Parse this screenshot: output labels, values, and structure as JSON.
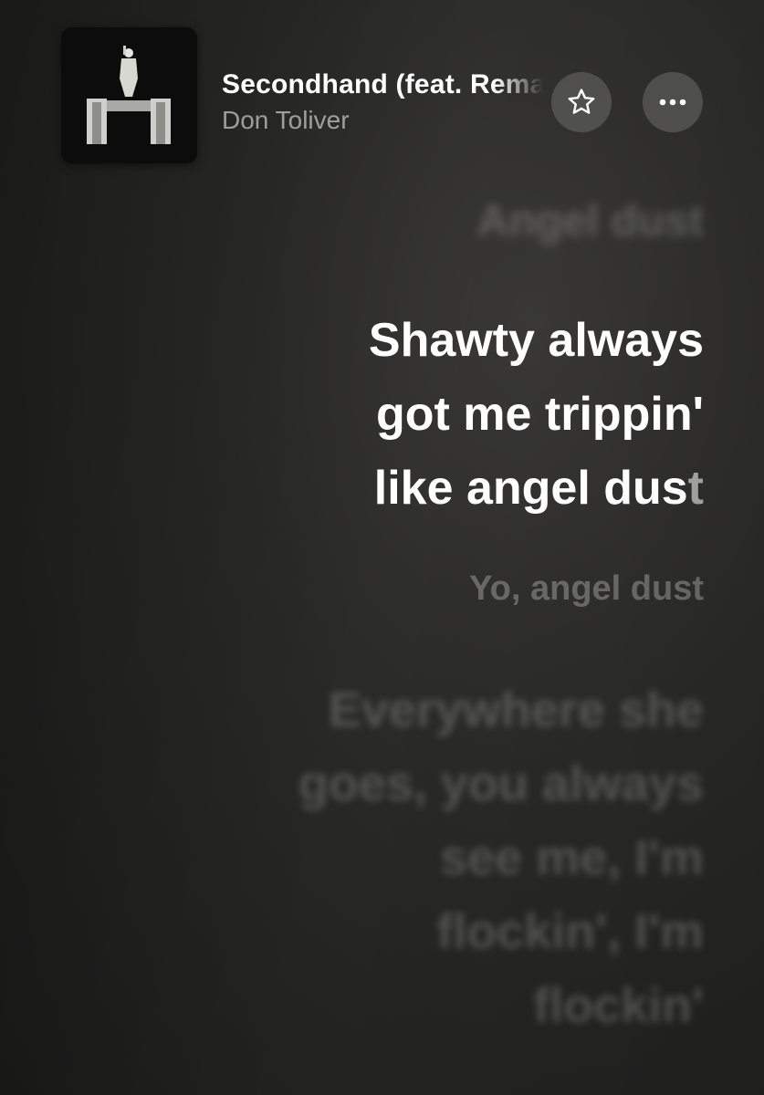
{
  "now_playing": {
    "title": "Secondhand (feat. Rema)",
    "artist": "Don Toliver"
  },
  "controls": {
    "favorite_icon": "star-outline-icon",
    "more_icon": "ellipsis-icon"
  },
  "lyrics": {
    "previous": "Angel dust",
    "active_main": "Shawty always\ngot me trippin'\nlike angel dus",
    "active_tail": "t",
    "next": "Yo, angel dust",
    "upcoming": "Everywhere she\ngoes, you always\nsee me, I'm\nflockin', I'm\nflockin'"
  },
  "colors": {
    "background": "#2a2a28",
    "text_active": "#ffffff",
    "button_bg": "#5a5a58"
  }
}
